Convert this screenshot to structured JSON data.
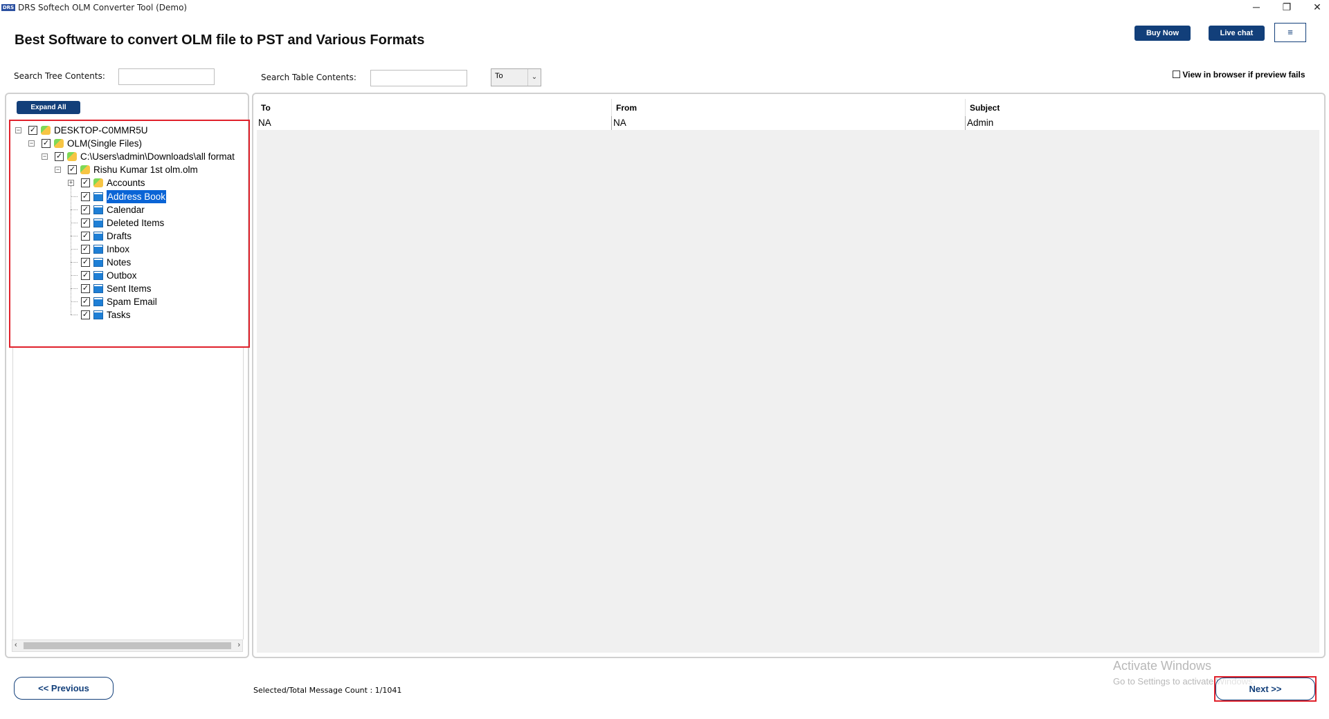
{
  "window": {
    "logo_text": "DRS",
    "title": "DRS Softech OLM Converter Tool (Demo)",
    "minimize_glyph": "─",
    "restore_glyph": "❐",
    "close_glyph": "✕"
  },
  "header": {
    "heading": "Best Software to convert OLM file to PST and Various Formats",
    "buy_now": "Buy Now",
    "live_chat": "Live chat",
    "menu_glyph": "≡"
  },
  "search": {
    "tree_label": "Search Tree Contents:",
    "tree_value": "",
    "table_label": "Search Table Contents:",
    "table_value": "",
    "column_select": "To",
    "view_in_browser": "View in browser if preview fails"
  },
  "tree": {
    "expand_all": "Expand All",
    "nodes": [
      {
        "label": "DESKTOP-C0MMR5U",
        "level": 0,
        "icon": "multi-color-icon",
        "expander": "⊟",
        "checked": true
      },
      {
        "label": "OLM(Single Files)",
        "level": 1,
        "icon": "multi-color-icon",
        "expander": "⊟",
        "checked": true
      },
      {
        "label": "C:\\Users\\admin\\Downloads\\all format",
        "level": 2,
        "icon": "multi-color-icon",
        "expander": "⊟",
        "checked": true
      },
      {
        "label": "Rishu Kumar 1st olm.olm",
        "level": 3,
        "icon": "multi-color-icon",
        "expander": "⊟",
        "checked": true
      },
      {
        "label": "Accounts",
        "level": 4,
        "icon": "multi-color-icon",
        "expander": "⊞",
        "checked": true
      },
      {
        "label": "Address Book",
        "level": 4,
        "icon": "folder-icon",
        "expander": "",
        "checked": true,
        "selected": true
      },
      {
        "label": "Calendar",
        "level": 4,
        "icon": "folder-icon",
        "expander": "",
        "checked": true
      },
      {
        "label": "Deleted Items",
        "level": 4,
        "icon": "folder-icon",
        "expander": "",
        "checked": true
      },
      {
        "label": "Drafts",
        "level": 4,
        "icon": "folder-icon",
        "expander": "",
        "checked": true
      },
      {
        "label": "Inbox",
        "level": 4,
        "icon": "folder-icon",
        "expander": "",
        "checked": true
      },
      {
        "label": "Notes",
        "level": 4,
        "icon": "folder-icon",
        "expander": "",
        "checked": true
      },
      {
        "label": "Outbox",
        "level": 4,
        "icon": "folder-icon",
        "expander": "",
        "checked": true
      },
      {
        "label": "Sent Items",
        "level": 4,
        "icon": "folder-icon",
        "expander": "",
        "checked": true
      },
      {
        "label": "Spam Email",
        "level": 4,
        "icon": "folder-icon",
        "expander": "",
        "checked": true
      },
      {
        "label": "Tasks",
        "level": 4,
        "icon": "folder-icon",
        "expander": "",
        "checked": true
      }
    ]
  },
  "table": {
    "columns": [
      "To",
      "From",
      "Subject"
    ],
    "rows": [
      [
        "NA",
        "NA",
        "Admin"
      ]
    ]
  },
  "footer": {
    "previous": "<< Previous",
    "next": "Next >>",
    "count": "Selected/Total Message Count : 1/1041"
  },
  "watermark": {
    "line1": "Activate Windows",
    "line2": "Go to Settings to activate Windows."
  },
  "colors": {
    "brand_blue": "#123f7a",
    "highlight_red": "#e0202a",
    "selection_blue": "#0a64d6"
  }
}
